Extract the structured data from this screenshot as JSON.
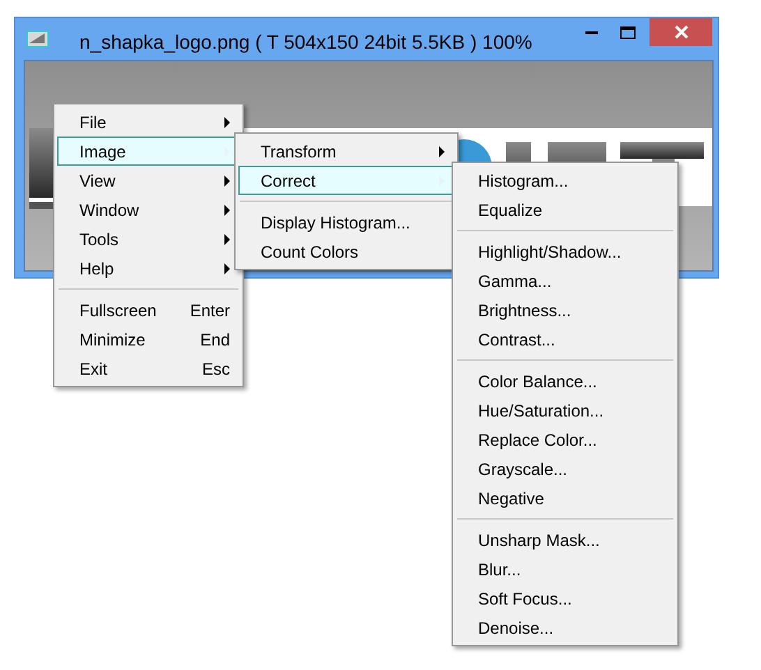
{
  "window": {
    "title": "n_shapka_logo.png  ( T  504x150  24bit  5.5KB )  100%",
    "buttons": [
      {
        "kind": "minimize"
      },
      {
        "kind": "maximize"
      },
      {
        "kind": "close"
      }
    ]
  },
  "menus": [
    {
      "items": [
        {
          "kind": "item",
          "label": "File",
          "submenu": true,
          "selected": false
        },
        {
          "kind": "item",
          "label": "Image",
          "submenu": true,
          "selected": true
        },
        {
          "kind": "item",
          "label": "View",
          "submenu": true,
          "selected": false
        },
        {
          "kind": "item",
          "label": "Window",
          "submenu": true,
          "selected": false
        },
        {
          "kind": "item",
          "label": "Tools",
          "submenu": true,
          "selected": false
        },
        {
          "kind": "item",
          "label": "Help",
          "submenu": true,
          "selected": false
        },
        {
          "kind": "separator"
        },
        {
          "kind": "item",
          "label": "Fullscreen",
          "shortcut": "Enter",
          "selected": false
        },
        {
          "kind": "item",
          "label": "Minimize",
          "shortcut": "End",
          "selected": false
        },
        {
          "kind": "item",
          "label": "Exit",
          "shortcut": "Esc",
          "selected": false
        }
      ]
    },
    {
      "items": [
        {
          "kind": "item",
          "label": "Transform",
          "submenu": true,
          "selected": false
        },
        {
          "kind": "item",
          "label": "Correct",
          "submenu": true,
          "selected": true
        },
        {
          "kind": "separator"
        },
        {
          "kind": "item",
          "label": "Display Histogram...",
          "selected": false
        },
        {
          "kind": "item",
          "label": "Count Colors",
          "selected": false
        }
      ]
    },
    {
      "items": [
        {
          "kind": "item",
          "label": "Histogram...",
          "selected": false
        },
        {
          "kind": "item",
          "label": "Equalize",
          "selected": false
        },
        {
          "kind": "separator"
        },
        {
          "kind": "item",
          "label": "Highlight/Shadow...",
          "selected": false
        },
        {
          "kind": "item",
          "label": "Gamma...",
          "selected": false
        },
        {
          "kind": "item",
          "label": "Brightness...",
          "selected": false
        },
        {
          "kind": "item",
          "label": "Contrast...",
          "selected": false
        },
        {
          "kind": "separator"
        },
        {
          "kind": "item",
          "label": "Color Balance...",
          "selected": false
        },
        {
          "kind": "item",
          "label": "Hue/Saturation...",
          "selected": false
        },
        {
          "kind": "item",
          "label": "Replace Color...",
          "selected": false
        },
        {
          "kind": "item",
          "label": "Grayscale...",
          "selected": false
        },
        {
          "kind": "item",
          "label": "Negative",
          "selected": false
        },
        {
          "kind": "separator"
        },
        {
          "kind": "item",
          "label": "Unsharp Mask...",
          "selected": false
        },
        {
          "kind": "item",
          "label": "Blur...",
          "selected": false
        },
        {
          "kind": "item",
          "label": "Soft Focus...",
          "selected": false
        },
        {
          "kind": "item",
          "label": "Denoise...",
          "selected": false
        }
      ]
    }
  ]
}
